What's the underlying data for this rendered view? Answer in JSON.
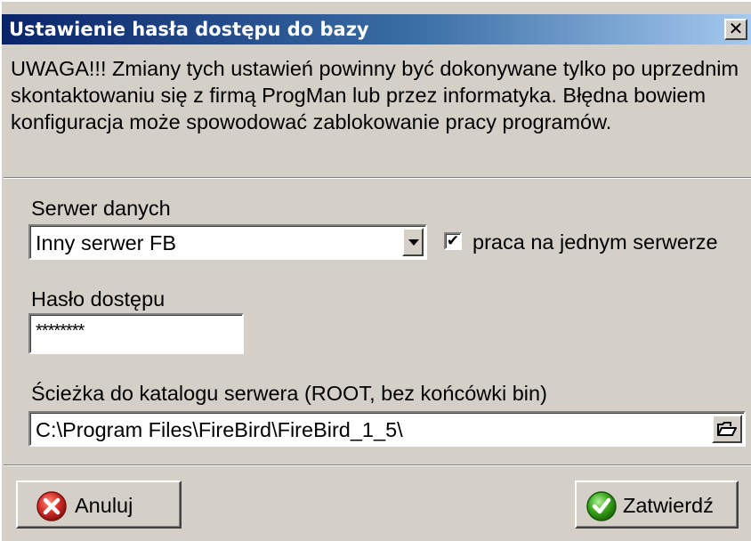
{
  "window": {
    "title": "Ustawienie hasła dostępu do bazy",
    "close_glyph": "✕"
  },
  "warning_text": "UWAGA!!! Zmiany tych ustawień powinny być dokonywane tylko po uprzednim skontaktowaniu się z firmą ProgMan lub przez informatyka. Błędna bowiem konfiguracja może spowodować zablokowanie pracy programów.",
  "server": {
    "label": "Serwer danych",
    "selected": "Inny serwer FB",
    "checkbox_label": "praca na jednym serwerze",
    "checkbox_checked": true,
    "check_glyph": "✔"
  },
  "password": {
    "label": "Hasło dostępu",
    "value": "********"
  },
  "path": {
    "label": "Ścieżka do katalogu serwera (ROOT, bez końcówki bin)",
    "value": "C:\\Program Files\\FireBird\\FireBird_1_5\\"
  },
  "buttons": {
    "cancel_label": "Anuluj",
    "confirm_label": "Zatwierdź"
  },
  "icons": {
    "cancel": "red-x-circle-icon",
    "confirm": "green-check-circle-icon",
    "folder": "open-folder-icon",
    "dropdown": "chevron-down-icon"
  },
  "colors": {
    "title_gradient_start": "#0a246a",
    "title_gradient_end": "#a6caf0",
    "face": "#d4d0c8",
    "cancel_icon": "#d9302a",
    "confirm_icon": "#3aa81c"
  }
}
